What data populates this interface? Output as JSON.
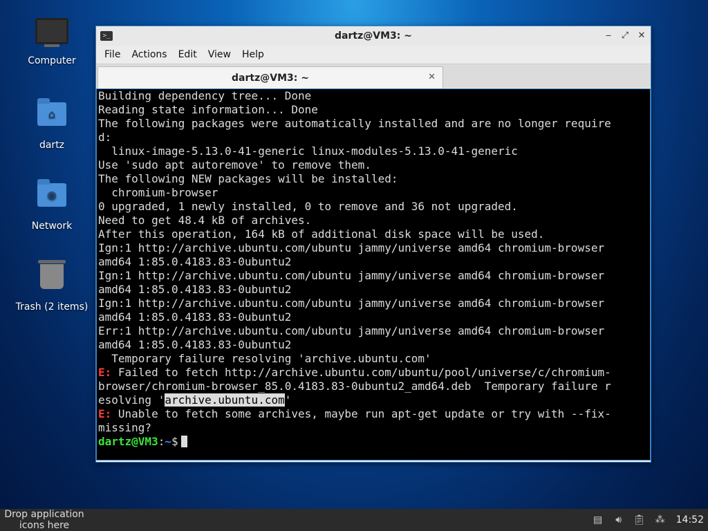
{
  "desktop": {
    "icons": [
      {
        "label": "Computer",
        "icon": "computer-icon"
      },
      {
        "label": "dartz",
        "icon": "home-folder-icon"
      },
      {
        "label": "Network",
        "icon": "network-folder-icon"
      },
      {
        "label": "Trash (2 items)",
        "icon": "trash-icon"
      }
    ]
  },
  "window": {
    "title": "dartz@VM3: ~",
    "buttons": {
      "minimize": "‒",
      "maximize": "⤢",
      "close": "✕"
    }
  },
  "menubar": {
    "items": [
      "File",
      "Actions",
      "Edit",
      "View",
      "Help"
    ]
  },
  "tab": {
    "label": "dartz@VM3: ~",
    "close": "✕"
  },
  "terminal": {
    "lines": [
      "Building dependency tree... Done",
      "Reading state information... Done",
      "The following packages were automatically installed and are no longer require",
      "d:",
      "  linux-image-5.13.0-41-generic linux-modules-5.13.0-41-generic",
      "Use 'sudo apt autoremove' to remove them.",
      "The following NEW packages will be installed:",
      "  chromium-browser",
      "0 upgraded, 1 newly installed, 0 to remove and 36 not upgraded.",
      "Need to get 48.4 kB of archives.",
      "After this operation, 164 kB of additional disk space will be used.",
      "Ign:1 http://archive.ubuntu.com/ubuntu jammy/universe amd64 chromium-browser",
      "amd64 1:85.0.4183.83-0ubuntu2",
      "Ign:1 http://archive.ubuntu.com/ubuntu jammy/universe amd64 chromium-browser",
      "amd64 1:85.0.4183.83-0ubuntu2",
      "Ign:1 http://archive.ubuntu.com/ubuntu jammy/universe amd64 chromium-browser",
      "amd64 1:85.0.4183.83-0ubuntu2",
      "Err:1 http://archive.ubuntu.com/ubuntu jammy/universe amd64 chromium-browser",
      "amd64 1:85.0.4183.83-0ubuntu2",
      "  Temporary failure resolving 'archive.ubuntu.com'"
    ],
    "error1": {
      "prefix": "E:",
      "line1": " Failed to fetch http://archive.ubuntu.com/ubuntu/pool/universe/c/chromium-",
      "line2": "browser/chromium-browser_85.0.4183.83-0ubuntu2_amd64.deb  Temporary failure r",
      "line3_before": "esolving '",
      "line3_highlight": "archive.ubuntu.com",
      "line3_after": "'"
    },
    "error2": {
      "prefix": "E:",
      "line1": " Unable to fetch some archives, maybe run apt-get update or try with --fix-",
      "line2": "missing?"
    },
    "prompt": {
      "user_host": "dartz@VM3",
      "sep": ":",
      "path": "~",
      "symbol": "$"
    }
  },
  "panel": {
    "launcher_text": "Drop application icons here",
    "clock": "14:52",
    "tray": [
      "notes-icon",
      "volume-icon",
      "clipboard-icon",
      "network-icon"
    ]
  },
  "colors": {
    "error": "#ff3b3b",
    "prompt_user": "#3ae43a",
    "prompt_path": "#3a8cff",
    "terminal_bg": "#000000",
    "terminal_fg": "#dcdcdc"
  }
}
